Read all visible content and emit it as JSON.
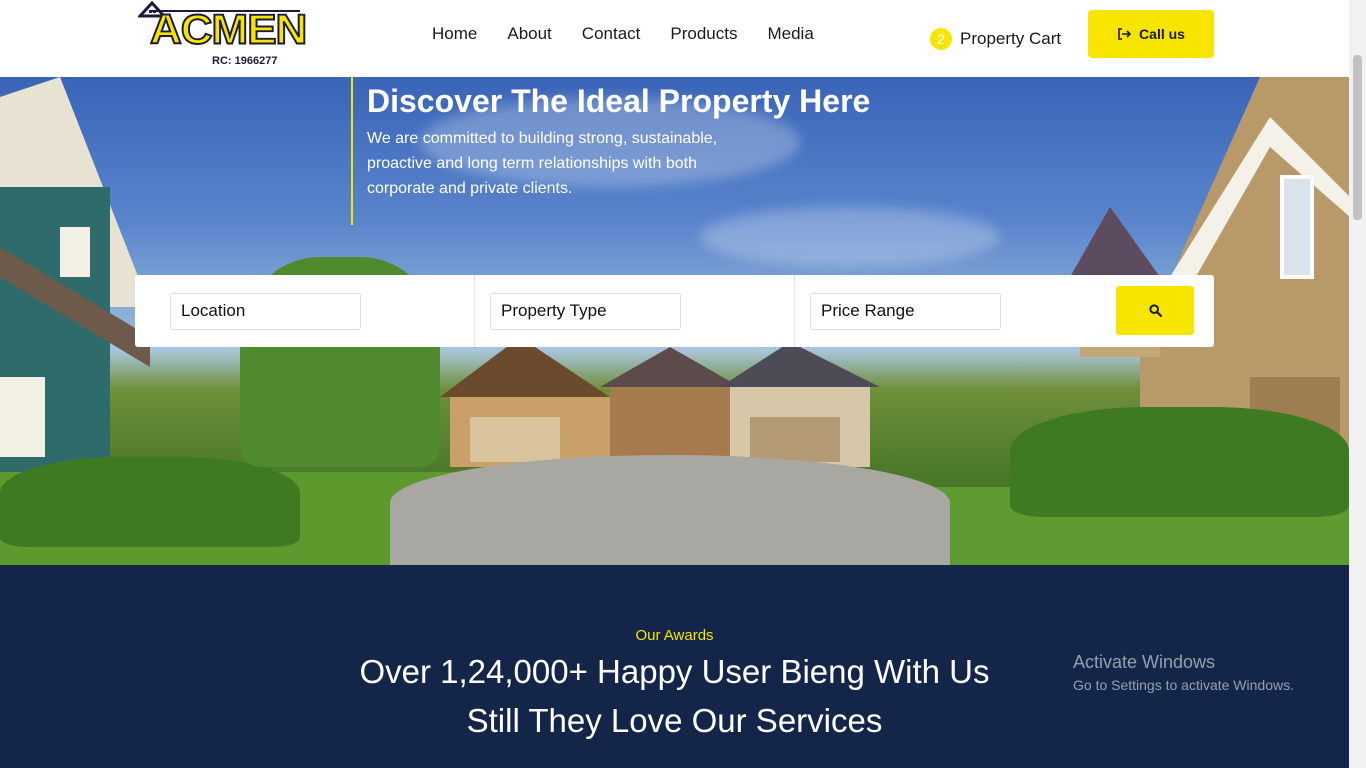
{
  "brand": {
    "name": "ACMEN",
    "rc": "RC: 1966277"
  },
  "nav": {
    "items": [
      "Home",
      "About",
      "Contact",
      "Products",
      "Media"
    ]
  },
  "cart": {
    "count": "2",
    "label": "Property Cart"
  },
  "call": {
    "label": "Call us",
    "icon": "sign-out-icon"
  },
  "hero": {
    "title": "Discover The Ideal Property Here",
    "subtitle": "We are committed to building strong, sustainable, proactive and long term relationships with both corporate and private clients."
  },
  "search": {
    "location_placeholder": "Location",
    "type_placeholder": "Property Type",
    "price_placeholder": "Price Range",
    "button_icon": "search-icon"
  },
  "awards": {
    "kicker": "Our Awards",
    "line1": "Over 1,24,000+ Happy User Bieng With Us",
    "line2": "Still They Love Our Services"
  },
  "watermark": {
    "title": "Activate Windows",
    "subtitle": "Go to Settings to activate Windows."
  },
  "colors": {
    "accent": "#f7e500",
    "navy": "#13264a",
    "text": "#1a1a1a"
  }
}
